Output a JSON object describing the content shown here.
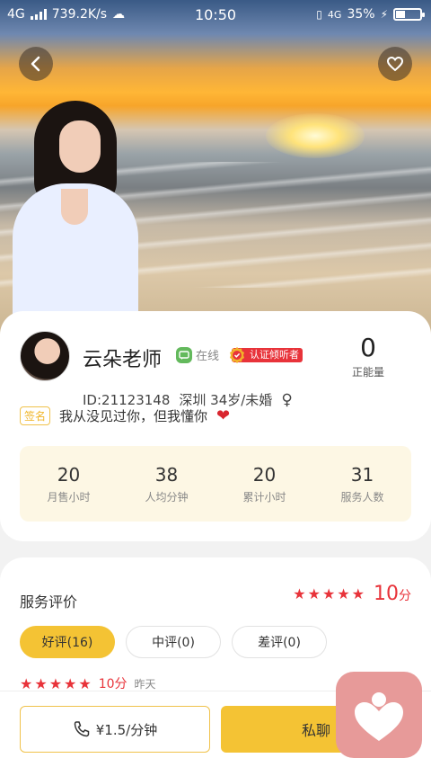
{
  "status_bar": {
    "network": "4G",
    "speed": "739.2K/s",
    "time": "10:50",
    "network_right": "4G",
    "battery": "35%",
    "battery_fraction": 0.35
  },
  "hero": {
    "back_icon": "chevron-left-icon",
    "favorite_icon": "heart-outline-icon"
  },
  "profile": {
    "name": "云朵老师",
    "online_label": "在线",
    "verified_label": "认证倾听者",
    "energy_value": "0",
    "energy_label": "正能量",
    "id_line": "ID:21123148",
    "city_age": "深圳 34岁/未婚",
    "gender_symbol": "♀",
    "sign_tag": "签名",
    "sign_text": "我从没见过你，但我懂你",
    "sign_emoji": "❤",
    "stats": [
      {
        "value": "20",
        "label": "月售小时"
      },
      {
        "value": "38",
        "label": "人均分钟"
      },
      {
        "value": "20",
        "label": "累计小时"
      },
      {
        "value": "31",
        "label": "服务人数"
      }
    ]
  },
  "reviews": {
    "title": "服务评价",
    "stars": 5,
    "score": "10",
    "score_unit": "分",
    "filters": [
      {
        "label": "好评(16)",
        "active": true
      },
      {
        "label": "中评(0)",
        "active": false
      },
      {
        "label": "差评(0)",
        "active": false
      }
    ],
    "item": {
      "stars": 5,
      "score": "10分",
      "time": "昨天"
    }
  },
  "bottom": {
    "call_label": "¥1.5/分钟",
    "chat_label": "私聊"
  },
  "colors": {
    "accent": "#f4c334",
    "red": "#e8333a",
    "online": "#63b95c",
    "float_app": "#e79a99"
  }
}
